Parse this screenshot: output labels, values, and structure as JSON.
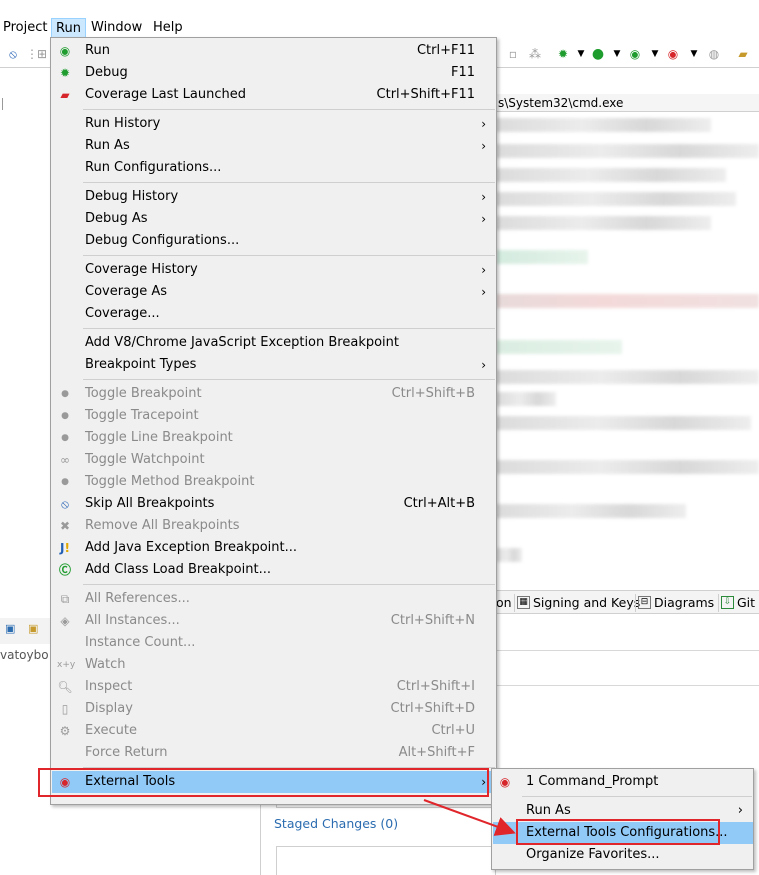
{
  "menubar": {
    "items": [
      {
        "label": "Project"
      },
      {
        "label": "Run"
      },
      {
        "label": "Window"
      },
      {
        "label": "Help"
      }
    ]
  },
  "editor": {
    "tab_title": "s\\System32\\cmd.exe"
  },
  "bottom_tabs": [
    {
      "label": "on"
    },
    {
      "label": "Signing and Keys"
    },
    {
      "label": "Diagrams"
    },
    {
      "label": "Git"
    }
  ],
  "left_panel": {
    "text": "vatoybo:"
  },
  "git": {
    "staged_label": "Staged Changes (0)"
  },
  "run_menu": {
    "items": [
      {
        "label": "Run",
        "accel": "Ctrl+F11",
        "icon": "run-icon"
      },
      {
        "label": "Debug",
        "accel": "F11",
        "icon": "debug-icon"
      },
      {
        "label": "Coverage Last Launched",
        "accel": "Ctrl+Shift+F11",
        "icon": "coverage-icon"
      },
      {
        "label": "Run History",
        "accel": "",
        "icon": ""
      },
      {
        "label": "Run As",
        "accel": "",
        "icon": ""
      },
      {
        "label": "Run Configurations...",
        "accel": "",
        "icon": ""
      },
      {
        "label": "Debug History",
        "accel": "",
        "icon": ""
      },
      {
        "label": "Debug As",
        "accel": "",
        "icon": ""
      },
      {
        "label": "Debug Configurations...",
        "accel": "",
        "icon": ""
      },
      {
        "label": "Coverage History",
        "accel": "",
        "icon": ""
      },
      {
        "label": "Coverage As",
        "accel": "",
        "icon": ""
      },
      {
        "label": "Coverage...",
        "accel": "",
        "icon": ""
      },
      {
        "label": "Add V8/Chrome JavaScript Exception Breakpoint",
        "accel": "",
        "icon": ""
      },
      {
        "label": "Breakpoint Types",
        "accel": "",
        "icon": ""
      },
      {
        "label": "Toggle Breakpoint",
        "accel": "Ctrl+Shift+B",
        "icon": "dot-icon"
      },
      {
        "label": "Toggle Tracepoint",
        "accel": "",
        "icon": "dot-icon"
      },
      {
        "label": "Toggle Line Breakpoint",
        "accel": "",
        "icon": "dot-icon"
      },
      {
        "label": "Toggle Watchpoint",
        "accel": "",
        "icon": "watchpoint-icon"
      },
      {
        "label": "Toggle Method Breakpoint",
        "accel": "",
        "icon": "dot-icon"
      },
      {
        "label": "Skip All Breakpoints",
        "accel": "Ctrl+Alt+B",
        "icon": "skip-breakpoints-icon"
      },
      {
        "label": "Remove All Breakpoints",
        "accel": "",
        "icon": "remove-breakpoints-icon"
      },
      {
        "label": "Add Java Exception Breakpoint...",
        "accel": "",
        "icon": "java-exception-icon"
      },
      {
        "label": "Add Class Load Breakpoint...",
        "accel": "",
        "icon": "class-load-icon"
      },
      {
        "label": "All References...",
        "accel": "",
        "icon": "references-icon"
      },
      {
        "label": "All Instances...",
        "accel": "Ctrl+Shift+N",
        "icon": "instances-icon"
      },
      {
        "label": "Instance Count...",
        "accel": "",
        "icon": ""
      },
      {
        "label": "Watch",
        "accel": "",
        "icon": "watch-icon"
      },
      {
        "label": "Inspect",
        "accel": "Ctrl+Shift+I",
        "icon": "inspect-icon"
      },
      {
        "label": "Display",
        "accel": "Ctrl+Shift+D",
        "icon": "display-icon"
      },
      {
        "label": "Execute",
        "accel": "Ctrl+U",
        "icon": "execute-icon"
      },
      {
        "label": "Force Return",
        "accel": "Alt+Shift+F",
        "icon": ""
      },
      {
        "label": "External Tools",
        "accel": "",
        "icon": "external-tools-icon"
      }
    ]
  },
  "external_tools_submenu": {
    "items": [
      {
        "label": "1 Command_Prompt"
      },
      {
        "label": "Run As"
      },
      {
        "label": "External Tools Configurations..."
      },
      {
        "label": "Organize Favorites..."
      }
    ]
  },
  "colors": {
    "highlight": "#91c9f7",
    "annotation_red": "#e0252b",
    "menu_bg": "#f0f0f0"
  }
}
